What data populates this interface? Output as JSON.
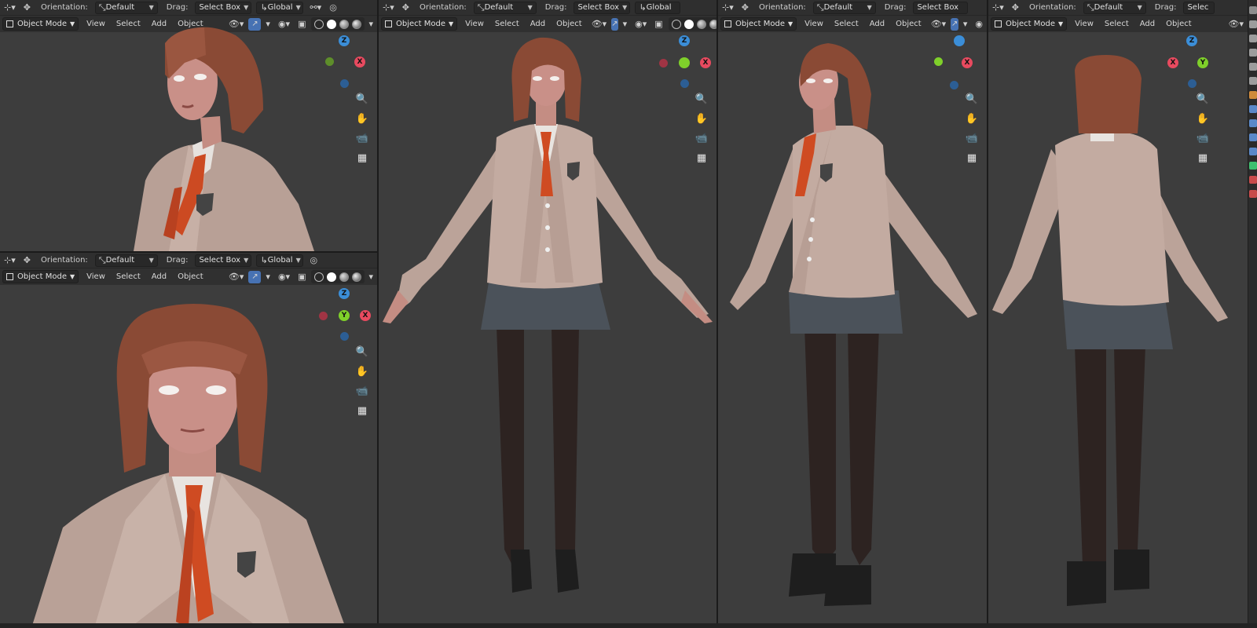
{
  "toolbar": {
    "orientation_label": "Orientation:",
    "orientation_value": "Default",
    "drag_label": "Drag:",
    "drag_value": "Select Box",
    "transform_value": "Global",
    "transform_value_short": "Glob",
    "drag_value_short": "Selec"
  },
  "header2": {
    "mode": "Object Mode",
    "menu_view": "View",
    "menu_select": "Select",
    "menu_add": "Add",
    "menu_object": "Object"
  },
  "gizmo": {
    "x": "X",
    "y": "Y",
    "z": "Z"
  },
  "icons": [
    "editor-type-icon",
    "transform-move-icon",
    "orientation-icon",
    "pivot-icon",
    "snap-icon",
    "proportional-icon",
    "visibility-icon",
    "gizmo-icon",
    "overlay-icon",
    "xray-icon",
    "zoom-icon",
    "hand-pan-icon",
    "camera-icon",
    "grid-ortho-icon"
  ],
  "colors": {
    "axis_x": "#e84a5f",
    "axis_y": "#7fd02a",
    "axis_z": "#3b8ed8",
    "active_toggle": "#4772b3",
    "viewport_bg": "#3d3d3d",
    "header_bg": "#2f2f2f"
  }
}
